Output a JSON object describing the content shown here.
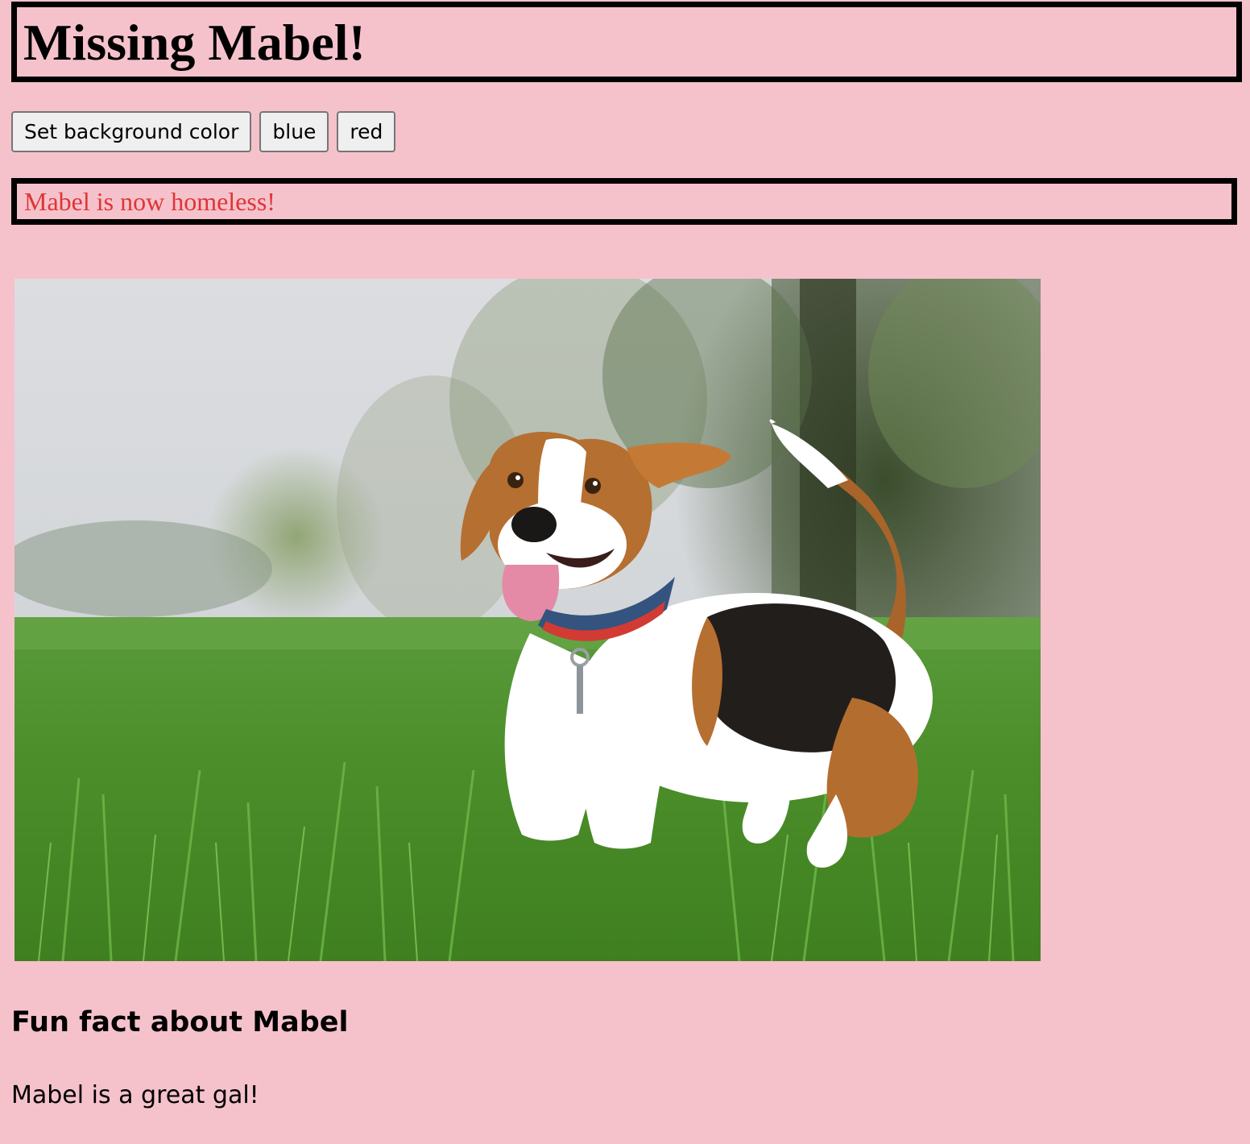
{
  "colors": {
    "page_background": "#f5c2cc",
    "status_text": "#e03535",
    "border": "#000000"
  },
  "header": {
    "title": "Missing Mabel!"
  },
  "controls": {
    "set_background_label": "Set background color",
    "blue_label": "blue",
    "red_label": "red"
  },
  "status": {
    "message": "Mabel is now homeless!"
  },
  "photo": {
    "subject": "beagle-dog-in-grass"
  },
  "fact": {
    "heading": "Fun fact about Mabel",
    "text": "Mabel is a great gal!"
  }
}
